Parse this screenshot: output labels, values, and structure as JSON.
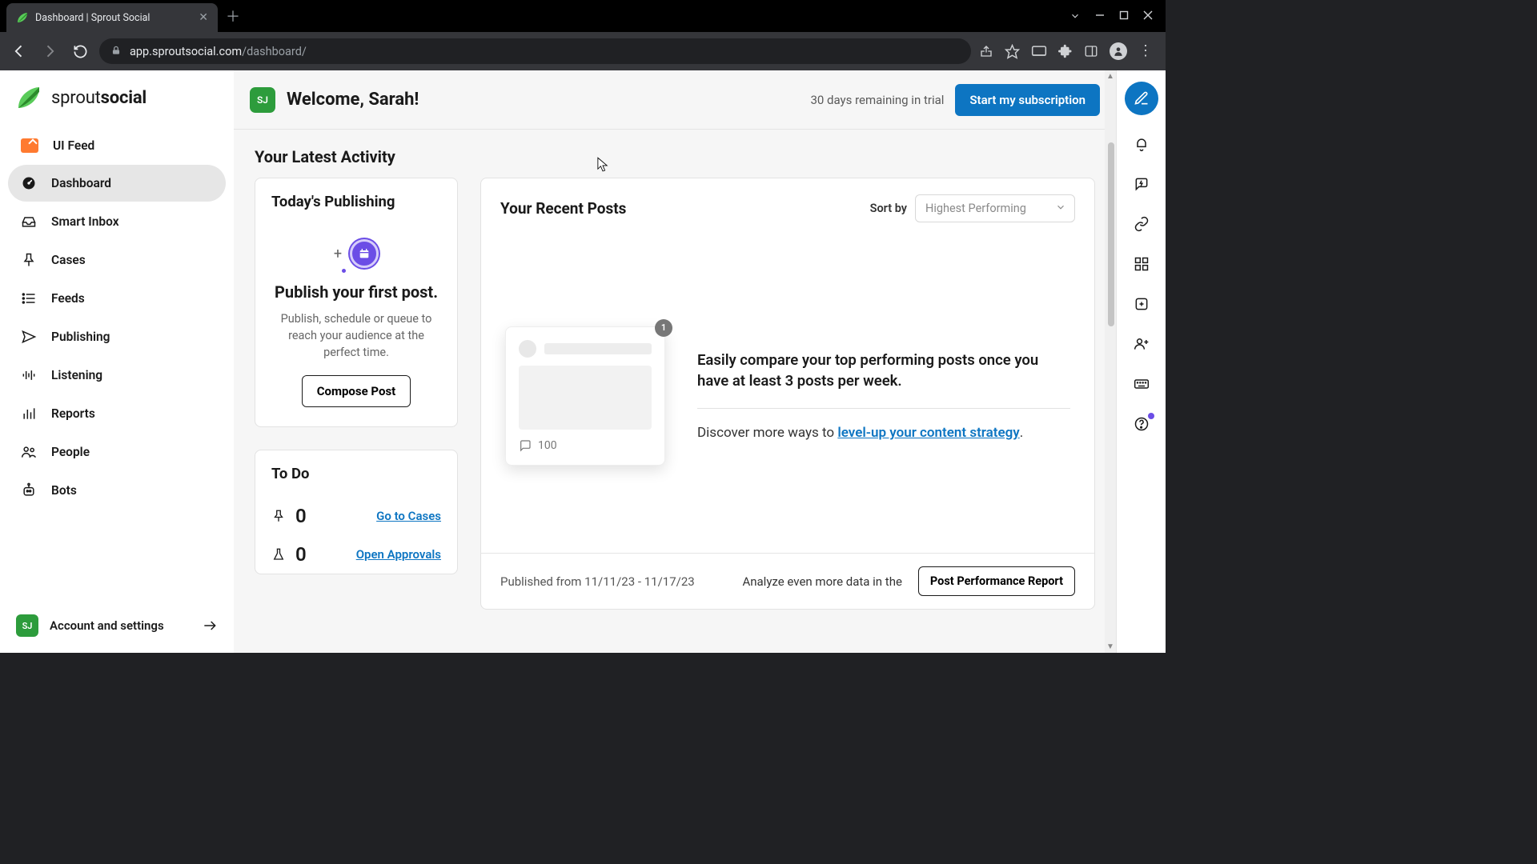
{
  "browser": {
    "tab_title": "Dashboard | Sprout Social",
    "url_host": "app.sproutsocial.com",
    "url_path": "/dashboard/"
  },
  "brand": {
    "word_left": "sprout",
    "word_right": "social"
  },
  "sidebar": {
    "items": [
      {
        "label": "UI Feed"
      },
      {
        "label": "Dashboard"
      },
      {
        "label": "Smart Inbox"
      },
      {
        "label": "Cases"
      },
      {
        "label": "Feeds"
      },
      {
        "label": "Publishing"
      },
      {
        "label": "Listening"
      },
      {
        "label": "Reports"
      },
      {
        "label": "People"
      },
      {
        "label": "Bots"
      }
    ],
    "settings_label": "Account and settings",
    "user_initials": "SJ"
  },
  "header": {
    "welcome": "Welcome, Sarah!",
    "trial_text": "30 days remaining in trial",
    "cta": "Start my subscription",
    "user_initials": "SJ"
  },
  "activity": {
    "section_title": "Your Latest Activity",
    "publishing": {
      "card_title": "Today's Publishing",
      "title": "Publish your first post.",
      "subtitle": "Publish, schedule or queue to reach your audience at the perfect time.",
      "button": "Compose Post"
    },
    "posts": {
      "title": "Your Recent Posts",
      "sort_label": "Sort by",
      "sort_value": "Highest Performing",
      "ghost_badge": "1",
      "ghost_count": "100",
      "copy_line": "Easily compare your top performing posts once you have at least 3 posts per week.",
      "discover_prefix": "Discover more ways to ",
      "discover_link": "level-up your content strategy",
      "discover_suffix": ".",
      "published_range": "Published from 11/11/23 - 11/17/23",
      "analyze_prefix": "Analyze even more data in the",
      "report_button": "Post Performance Report"
    },
    "todo": {
      "title": "To Do",
      "rows": [
        {
          "count": "0",
          "link": "Go to Cases"
        },
        {
          "count": "0",
          "link": "Open Approvals"
        }
      ]
    }
  }
}
